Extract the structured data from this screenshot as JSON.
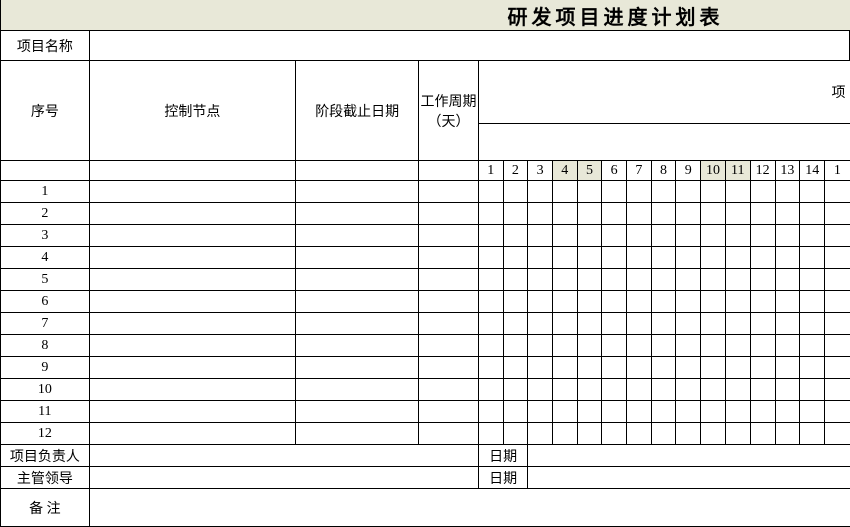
{
  "title": "研发项目进度计划表",
  "labels": {
    "project_name": "项目名称",
    "seq": "序号",
    "control_node": "控制节点",
    "phase_deadline": "阶段截止日期",
    "work_cycle": "工作周期（天）",
    "project_header_right": "项",
    "project_owner": "项目负责人",
    "supervisor": "主管领导",
    "date": "日期",
    "remark": "备 注"
  },
  "days": [
    "1",
    "2",
    "3",
    "4",
    "5",
    "6",
    "7",
    "8",
    "9",
    "10",
    "11",
    "12",
    "13",
    "14",
    "1"
  ],
  "highlighted_days": [
    4,
    5,
    10,
    11
  ],
  "rows": [
    1,
    2,
    3,
    4,
    5,
    6,
    7,
    8,
    9,
    10,
    11,
    12
  ]
}
